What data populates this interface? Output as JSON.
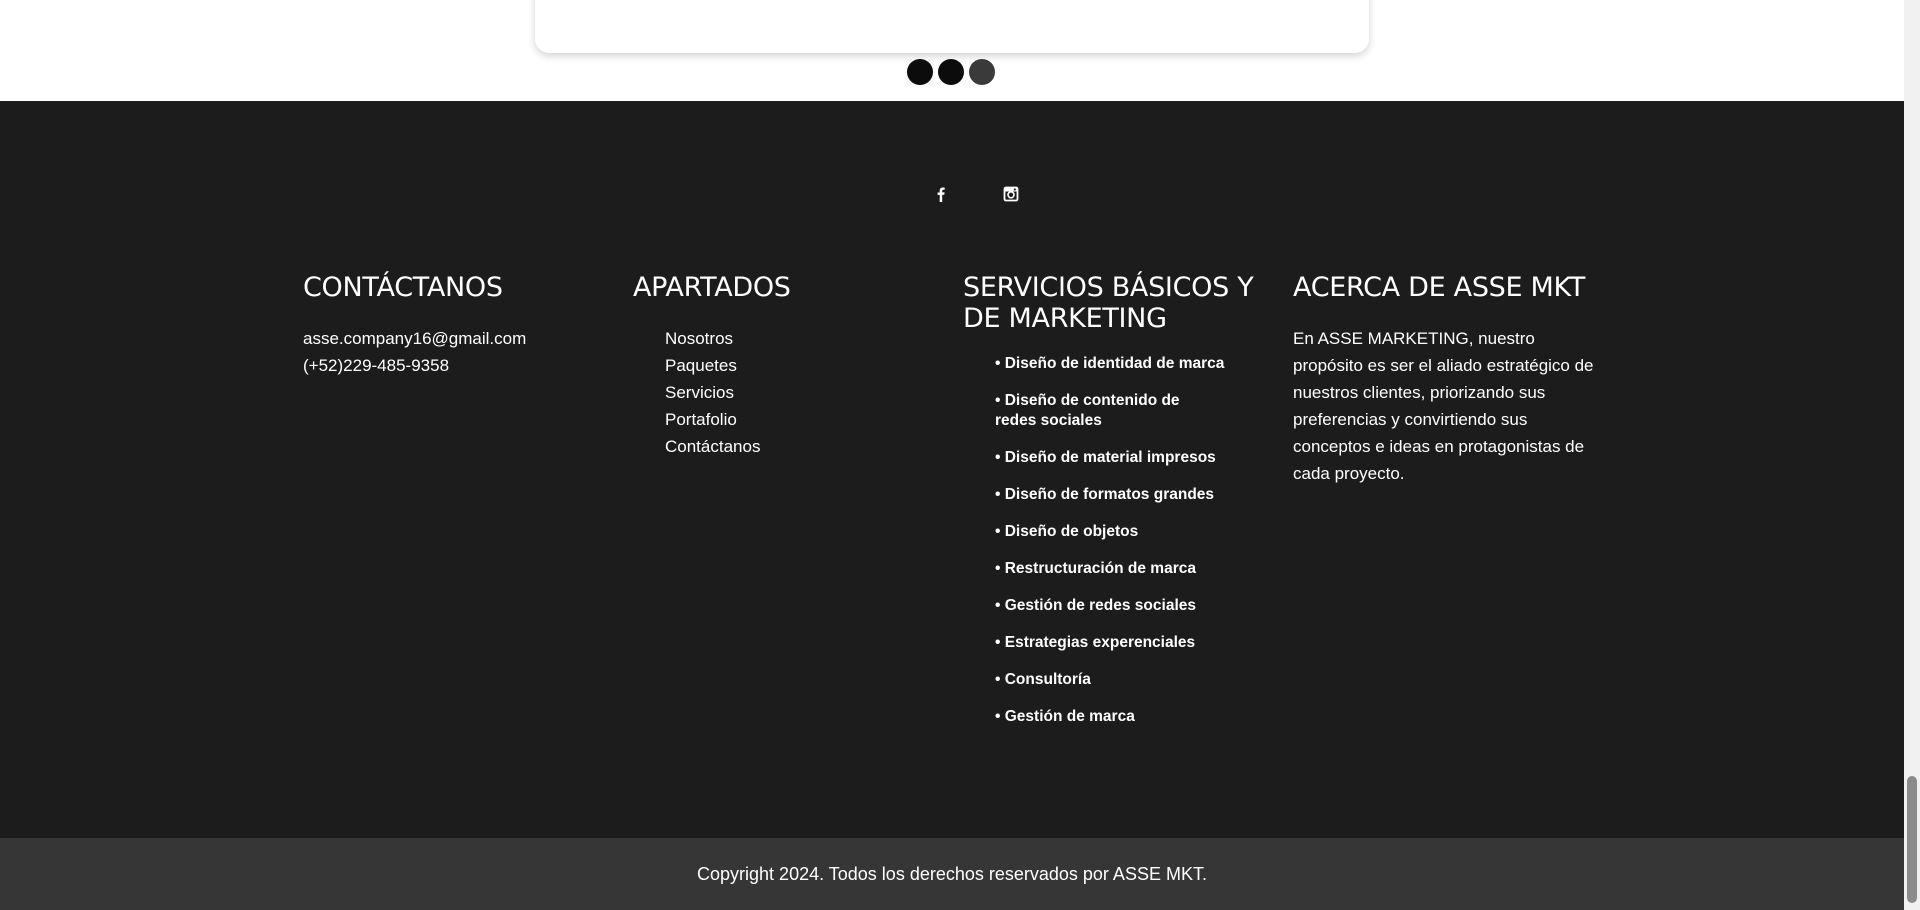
{
  "carousel": {
    "dots": [
      "slide-1",
      "slide-2",
      "slide-3"
    ]
  },
  "social": {
    "facebook_icon": "facebook-icon",
    "instagram_icon": "instagram-icon"
  },
  "contact": {
    "heading": "CONTÁCTANOS",
    "email": "asse.company16@gmail.com",
    "phone": "(+52)229-485-9358"
  },
  "sections": {
    "heading": "APARTADOS",
    "items": [
      "Nosotros",
      "Paquetes",
      "Servicios",
      "Portafolio",
      "Contáctanos"
    ]
  },
  "services": {
    "heading": "SERVICIOS BÁSICOS Y DE MARKETING",
    "items": [
      "• Diseño de identidad de marca",
      "• Diseño de contenido de redes sociales",
      "• Diseño de material impresos",
      "• Diseño de formatos grandes",
      "• Diseño de objetos",
      "• Restructuración de marca",
      "• Gestión de redes sociales",
      "• Estrategias experenciales",
      "• Consultoría",
      "• Gestión de marca"
    ]
  },
  "about": {
    "heading": "ACERCA DE ASSE MKT",
    "text": "En ASSE MARKETING, nuestro propósito es ser el aliado estratégico de nuestros clientes, priorizando sus preferencias y convirtiendo sus conceptos e ideas en protagonistas de cada proyecto."
  },
  "footer": {
    "copyright": "Copyright 2024. Todos los derechos reservados por ASSE MKT."
  },
  "colors": {
    "footer_bg": "#1c1c1c",
    "copyright_bg": "#363636",
    "text": "#ffffff"
  }
}
